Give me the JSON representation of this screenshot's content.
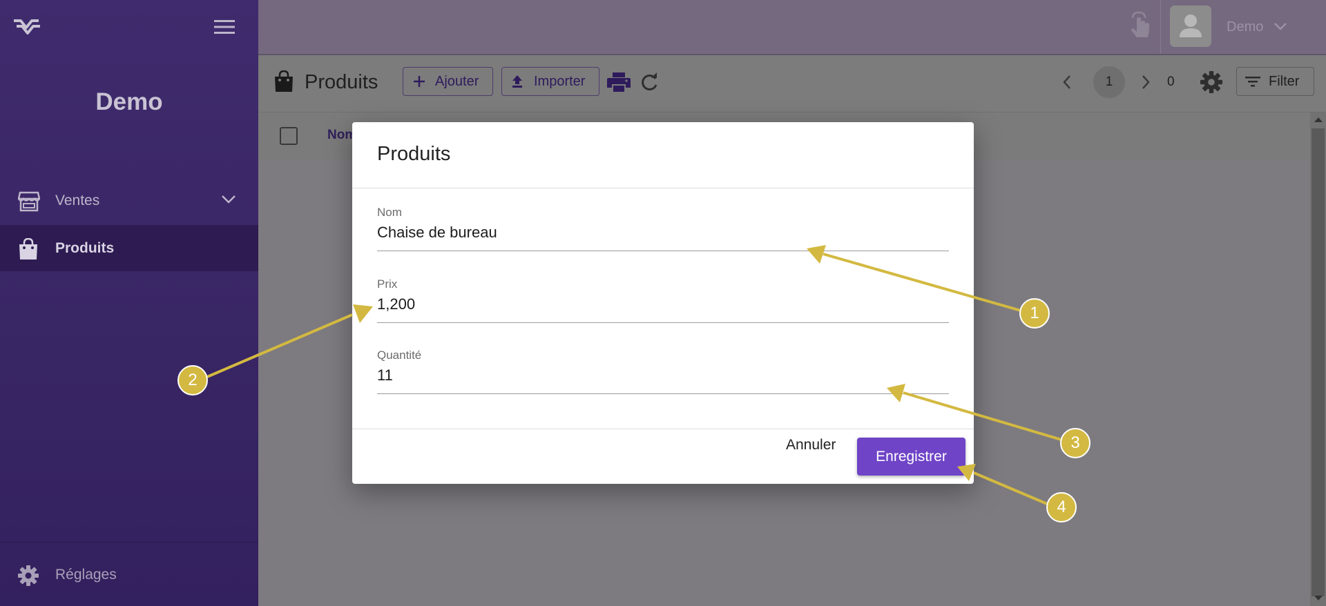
{
  "sidebar": {
    "brand": "Demo",
    "items": [
      {
        "label": "Ventes",
        "icon": "store-icon"
      },
      {
        "label": "Produits",
        "icon": "shopping-bag-icon"
      }
    ],
    "settings": {
      "label": "Réglages",
      "icon": "gear-icon"
    }
  },
  "topbar": {
    "user_name": "Demo"
  },
  "toolbar": {
    "title": "Produits",
    "add_label": "Ajouter",
    "import_label": "Importer",
    "current_page": "1",
    "total": "0",
    "filter_label": "Filter"
  },
  "table": {
    "first_column": "Nom"
  },
  "modal": {
    "title": "Produits",
    "fields": [
      {
        "label": "Nom",
        "value": "Chaise de bureau"
      },
      {
        "label": "Prix",
        "value": "1,200"
      },
      {
        "label": "Quantité",
        "value": "11"
      }
    ],
    "cancel_label": "Annuler",
    "save_label": "Enregistrer"
  },
  "annotations": [
    {
      "number": "1"
    },
    {
      "number": "2"
    },
    {
      "number": "3"
    },
    {
      "number": "4"
    }
  ],
  "colors": {
    "sidebar": "#3a2766",
    "primary": "#6f44c7",
    "annotation": "#d3b941"
  }
}
